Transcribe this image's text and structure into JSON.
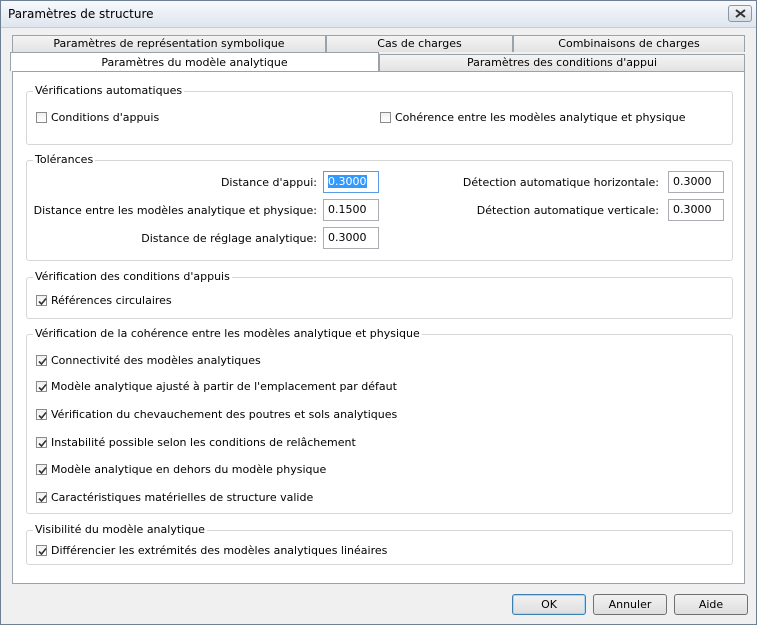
{
  "window": {
    "title": "Paramètres de structure"
  },
  "tabs": {
    "back": [
      "Paramètres de représentation symbolique",
      "Cas de charges",
      "Combinaisons de charges"
    ],
    "front": [
      "Paramètres du modèle analytique",
      "Paramètres des conditions d'appui"
    ]
  },
  "auto_checks": {
    "legend": "Vérifications automatiques",
    "items": [
      {
        "label": "Conditions d'appuis",
        "checked": false
      },
      {
        "label": "Cohérence entre les modèles analytique et physique",
        "checked": false
      }
    ]
  },
  "tolerances": {
    "legend": "Tolérances",
    "fields": [
      {
        "label": "Distance d'appui:",
        "value": "0.3000"
      },
      {
        "label": "Distance entre les modèles analytique et physique:",
        "value": "0.1500"
      },
      {
        "label": "Distance de réglage analytique:",
        "value": "0.3000"
      },
      {
        "label": "Détection automatique horizontale:",
        "value": "0.3000"
      },
      {
        "label": "Détection automatique verticale:",
        "value": "0.3000"
      }
    ]
  },
  "support_checks": {
    "legend": "Vérification des conditions d'appuis",
    "items": [
      {
        "label": "Références circulaires",
        "checked": true
      }
    ]
  },
  "consistency_checks": {
    "legend": "Vérification de la cohérence entre les modèles analytique et physique",
    "items": [
      {
        "label": "Connectivité des modèles analytiques",
        "checked": true
      },
      {
        "label": "Modèle analytique ajusté à partir de l'emplacement par défaut",
        "checked": true
      },
      {
        "label": "Vérification du chevauchement des poutres et sols analytiques",
        "checked": true
      },
      {
        "label": "Instabilité possible selon les conditions de relâchement",
        "checked": true
      },
      {
        "label": "Modèle analytique en dehors du modèle physique",
        "checked": true
      },
      {
        "label": "Caractéristiques matérielles de structure valide",
        "checked": true
      }
    ]
  },
  "visibility": {
    "legend": "Visibilité du modèle analytique",
    "items": [
      {
        "label": "Différencier les extrémités des modèles analytiques linéaires",
        "checked": true
      }
    ]
  },
  "buttons": {
    "ok": "OK",
    "cancel": "Annuler",
    "help": "Aide"
  }
}
